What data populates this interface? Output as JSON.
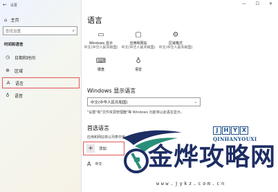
{
  "window": {
    "title": "设置",
    "controls": {
      "minimize": "—",
      "maximize": "☐",
      "close": "✕"
    }
  },
  "sidebar": {
    "home_label": "主页",
    "search_placeholder": "查找设置",
    "section_title": "时间和语言",
    "items": [
      {
        "label": "日期和时间",
        "icon": "calendar-clock-icon"
      },
      {
        "label": "区域",
        "icon": "region-icon"
      },
      {
        "label": "语言",
        "icon": "language-icon",
        "selected": true
      },
      {
        "label": "语音",
        "icon": "microphone-icon"
      }
    ]
  },
  "main": {
    "title": "语言",
    "tiles": [
      {
        "label": "Windows 显示",
        "sub": "中文(中华人民共和国)",
        "icon": "monitor-icon"
      },
      {
        "label": "应用和网站",
        "sub": "中文(中华人民共和国)",
        "icon": "window-icon"
      },
      {
        "label": "区域格式",
        "sub": "中文(中华人民共和国)",
        "icon": "globe-gear-icon"
      },
      {
        "label": "键盘",
        "sub": "",
        "icon": "keyboard-icon"
      },
      {
        "label": "语音",
        "sub": "",
        "icon": "microphone-icon"
      }
    ],
    "display_language": {
      "heading": "Windows 显示语言",
      "selected": "中文(中华人民共和国)",
      "note": "\"设置\"和\"文件资源管理器\"等 Windows 功能将以此语言显示。"
    },
    "preferred": {
      "heading": "首选语言",
      "note": "应用和网站将以列表中第一个受",
      "add_label": "添加",
      "first_language": "中文"
    }
  },
  "watermark": {
    "brand_letters": [
      "J",
      "H",
      "Y",
      "X"
    ],
    "brand_latin": "QINHANYOUXI",
    "cn_text": "金烨攻略网",
    "url": "www.jykz.com.cn"
  }
}
